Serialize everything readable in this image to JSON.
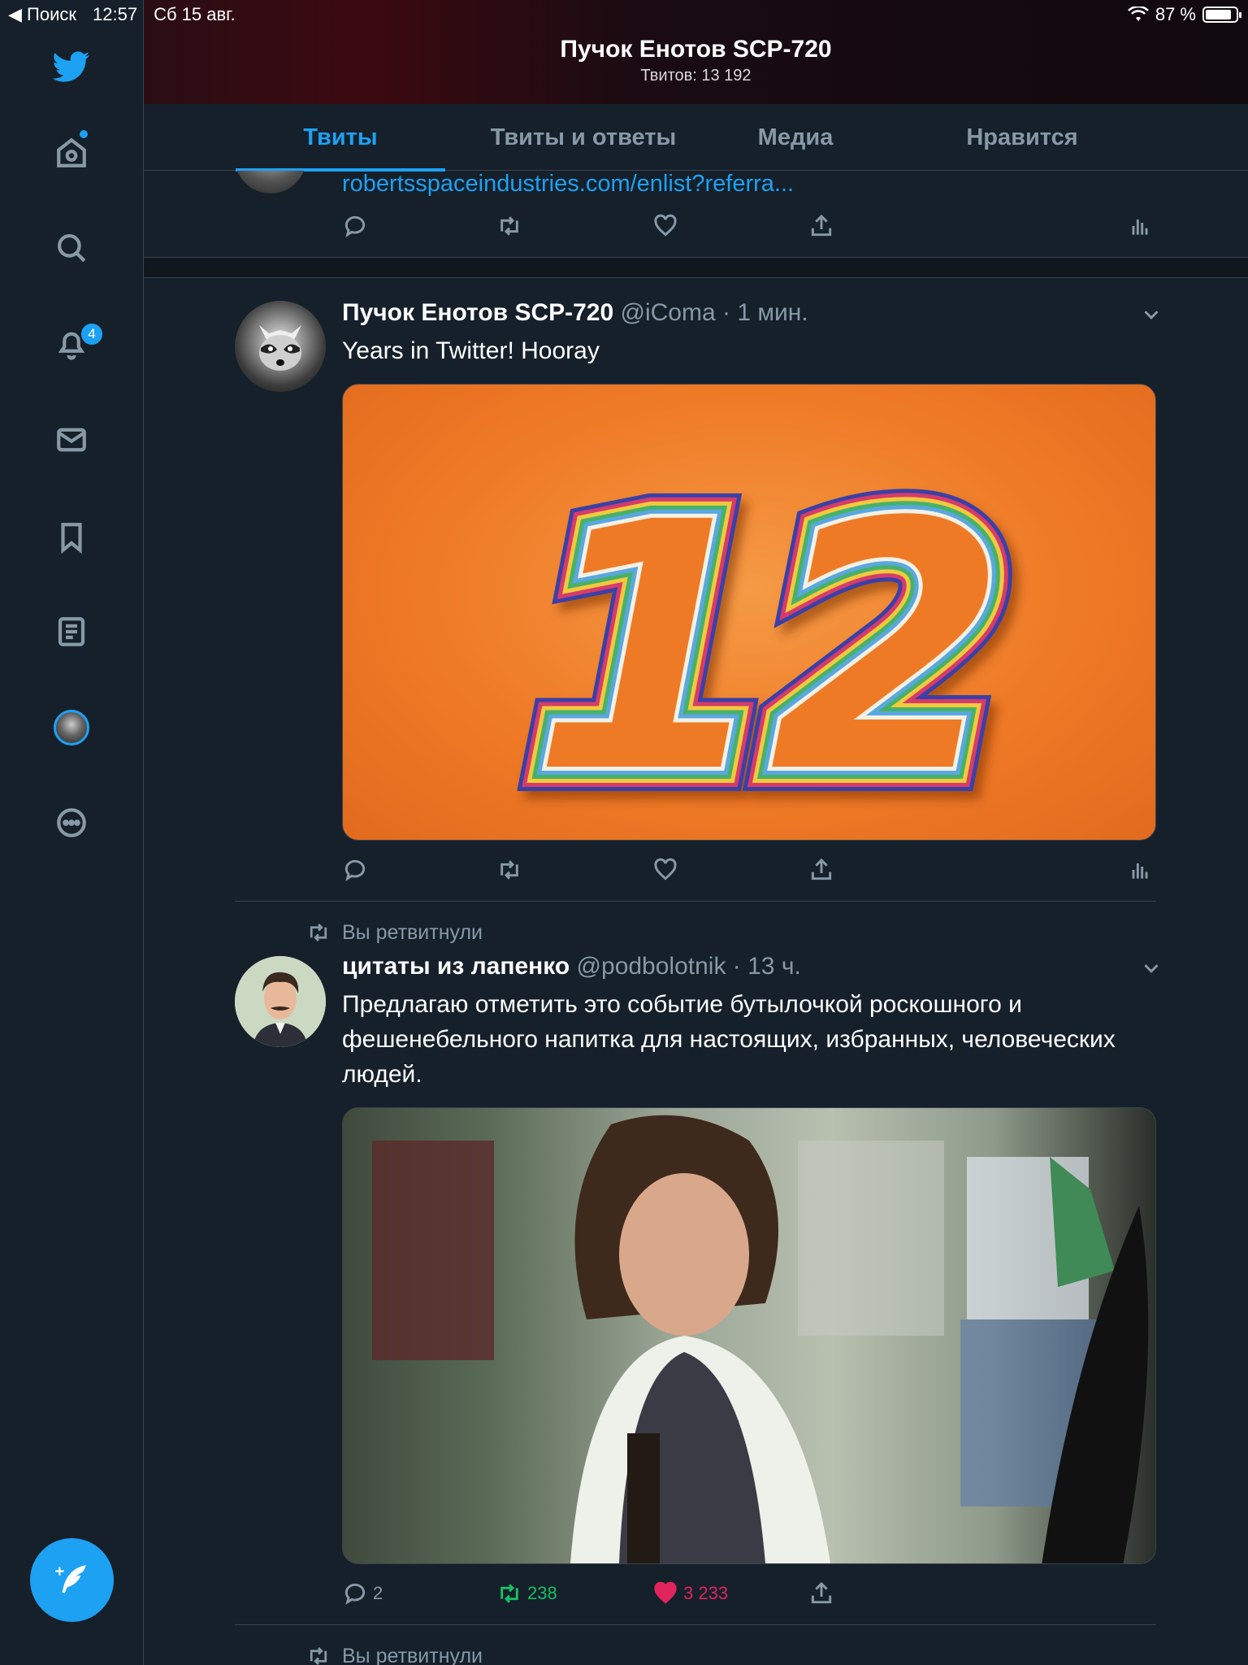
{
  "status_bar": {
    "back_label": "◀ Поиск",
    "time": "12:57",
    "date": "Сб 15 авг.",
    "battery": "87 %"
  },
  "sidebar": {
    "notifications_count": "4",
    "items": [
      {
        "icon": "twitter-logo-icon"
      },
      {
        "icon": "home-icon"
      },
      {
        "icon": "search-icon"
      },
      {
        "icon": "notifications-bell-icon"
      },
      {
        "icon": "messages-mail-icon"
      },
      {
        "icon": "bookmarks-icon"
      },
      {
        "icon": "lists-icon"
      },
      {
        "icon": "profile-avatar"
      },
      {
        "icon": "more-icon"
      }
    ],
    "compose_icon": "compose-tweet-icon"
  },
  "header": {
    "title": "Пучок Енотов SCP-720",
    "subtitle": "Твитов: 13 192"
  },
  "tabs": [
    {
      "label": "Твиты",
      "active": true
    },
    {
      "label": "Твиты и ответы",
      "active": false
    },
    {
      "label": "Медиа",
      "active": false
    },
    {
      "label": "Нравится",
      "active": false
    }
  ],
  "feed": {
    "previous_tweet": {
      "link": "robertsspaceindustries.com/enlist?referra..."
    },
    "tweet1": {
      "name": "Пучок Енотов SCP-720",
      "meta": " @iComa · 1 мин.",
      "text": "Years in Twitter! Hooray",
      "image_number": "12",
      "image_bg": "#ef7a26"
    },
    "tweet2": {
      "retweet_label": "Вы ретвитнули",
      "name": "цитаты из лапенко",
      "meta": " @podbolotnik · 13 ч.",
      "text": "Предлагаю отметить это событие бутылочкой роскошного и фешенебельного напитка для настоящих, избранных, человеческих людей.",
      "replies": "2",
      "retweets": "238",
      "likes": "3 233"
    },
    "next_retweet_label": "Вы ретвитнули"
  },
  "colors": {
    "accent": "#1da1f2",
    "background": "#15202b",
    "retweet": "#17bf63",
    "like": "#e0245e"
  }
}
